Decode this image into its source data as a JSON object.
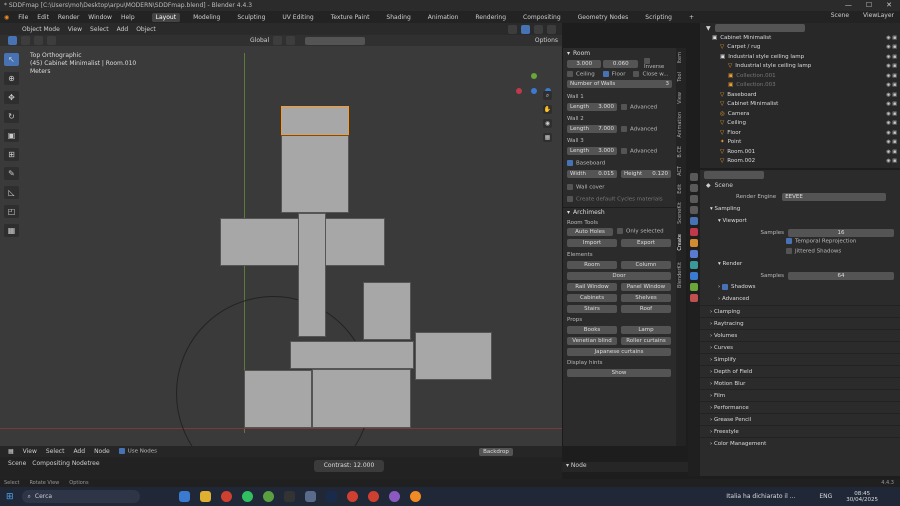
{
  "titlebar": {
    "title": "* SDDFmap [C:\\Users\\mol\\Desktop\\arpu\\MODERN\\SDDFmap.blend] - Blender 4.4.3",
    "min": "—",
    "max": "☐",
    "close": "✕"
  },
  "menu": {
    "items": [
      "File",
      "Edit",
      "Render",
      "Window",
      "Help"
    ],
    "workspaces": [
      "Layout",
      "Modeling",
      "Sculpting",
      "UV Editing",
      "Texture Paint",
      "Shading",
      "Animation",
      "Rendering",
      "Compositing",
      "Geometry Nodes",
      "Scripting",
      "+"
    ],
    "scene": "Scene",
    "view_layer": "ViewLayer"
  },
  "viewport": {
    "mode": "Object Mode",
    "menus": [
      "View",
      "Select",
      "Add",
      "Object"
    ],
    "orientation": "Global",
    "options": "Options",
    "view_name": "Top Orthographic",
    "collection": "(45) Cabinet Minimalist | Room.010",
    "units": "Meters"
  },
  "npanel": {
    "room_title": "Room",
    "width": "3.000",
    "depth": "0.060",
    "inverse": "Inverse",
    "ceiling": "Ceiling",
    "floor": "Floor",
    "close": "Close w...",
    "walls_label": "Number of Walls",
    "walls_value": "3",
    "walls": [
      {
        "name": "Wall 1",
        "length": "Length",
        "value": "3.000",
        "adv": "Advanced"
      },
      {
        "name": "Wall 2",
        "length": "Length",
        "value": "7.000",
        "adv": "Advanced"
      },
      {
        "name": "Wall 3",
        "length": "Length",
        "value": "3.000",
        "adv": "Advanced"
      }
    ],
    "baseboard": "Baseboard",
    "bb_width": "Width",
    "bb_width_val": "0.015",
    "bb_height": "Height",
    "bb_height_val": "0.120",
    "wall_cover": "Wall cover",
    "create_mats": "Create default Cycles materials",
    "archimesh": "Archimesh",
    "room_tools": "Room Tools",
    "auto_holes": "Auto Holes",
    "only_selected": "Only selected",
    "import": "Import",
    "export": "Export",
    "elements": "Elements",
    "el_buttons": [
      "Room",
      "Column",
      "Door",
      "Rail Window",
      "Panel Window",
      "Cabinets",
      "Shelves",
      "Stairs",
      "Roof"
    ],
    "props": "Props",
    "props_buttons": [
      "Books",
      "Lamp",
      "Venetian blind",
      "Roller curtains",
      "Japanese curtains"
    ],
    "display_hints": "Display hints",
    "show": "Show",
    "tabs": [
      "Item",
      "Tool",
      "View",
      "Animation",
      "B.CE",
      "ACT",
      "Edit",
      "SceneKit",
      "Create",
      "BlenderKit"
    ]
  },
  "outliner": {
    "search_placeholder": "",
    "items": [
      {
        "name": "Cabinet Minimalist",
        "indent": 0,
        "type": "collection"
      },
      {
        "name": "Carpet / rug",
        "indent": 1,
        "type": "object"
      },
      {
        "name": "Industrial style ceiling lamp",
        "indent": 1,
        "type": "collection"
      },
      {
        "name": "Industrial style ceiling lamp",
        "indent": 2,
        "type": "object"
      },
      {
        "name": "Collection.001",
        "indent": 2,
        "type": "dim"
      },
      {
        "name": "Collection.003",
        "indent": 2,
        "type": "dim"
      },
      {
        "name": "Baseboard",
        "indent": 1,
        "type": "object"
      },
      {
        "name": "Cabinet Minimalist",
        "indent": 1,
        "type": "object"
      },
      {
        "name": "Camera",
        "indent": 1,
        "type": "camera"
      },
      {
        "name": "Ceiling",
        "indent": 1,
        "type": "object"
      },
      {
        "name": "Floor",
        "indent": 1,
        "type": "object"
      },
      {
        "name": "Point",
        "indent": 1,
        "type": "light"
      },
      {
        "name": "Room.001",
        "indent": 1,
        "type": "object"
      },
      {
        "name": "Room.002",
        "indent": 1,
        "type": "object"
      }
    ]
  },
  "properties": {
    "scene": "Scene",
    "render_engine_label": "Render Engine",
    "render_engine": "EEVEE",
    "sampling": "Sampling",
    "viewport": "Viewport",
    "samples_label": "Samples",
    "viewport_samples": "16",
    "temporal": "Temporal Reprojection",
    "jittered": "Jittered Shadows",
    "render": "Render",
    "render_samples": "64",
    "shadows": "Shadows",
    "advanced": "Advanced",
    "sections": [
      "Clamping",
      "Raytracing",
      "Volumes",
      "Curves",
      "Simplify",
      "Depth of Field",
      "Motion Blur",
      "Film",
      "Performance",
      "Grease Pencil",
      "Freestyle",
      "Color Management"
    ]
  },
  "nodebar": {
    "items": [
      "View",
      "Select",
      "Add",
      "Node"
    ],
    "use_nodes": "Use Nodes",
    "backdrop": "Backdrop",
    "node": "Node",
    "scene": "Scene",
    "tree": "Compositing Nodetree",
    "contrast": "Contrast",
    "contrast_value": "12.000"
  },
  "statusbar": {
    "items": [
      "Select",
      "Rotate View",
      "Options"
    ],
    "version": "4.4.3"
  },
  "taskbar": {
    "search": "Cerca",
    "notification": "Italia ha dichiarato il ...",
    "lang": "ENG",
    "time": "08:45",
    "date": "30/04/2025"
  },
  "colors": {
    "accent": "#4772b3",
    "selected": "#ff9a1f",
    "viewport_bg": "#3a3a3a"
  }
}
